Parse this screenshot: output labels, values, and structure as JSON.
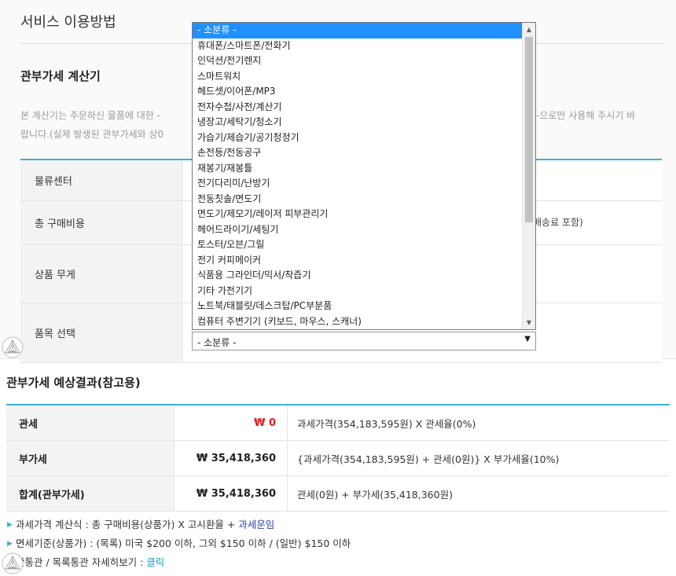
{
  "service": {
    "title": "서비스 이용방법"
  },
  "calculator": {
    "title": "관부가세 계산기",
    "desc_line1_left": "본 계산기는 주문하신 물품에 대한 -",
    "desc_line1_right": "-으로만 사용해 주시기 바",
    "desc_line2": "랍니다.(실제 발생된 관부가세와 상0",
    "rows": [
      {
        "label": "물류센터"
      },
      {
        "label": "총 구매비용",
        "note": "배송료 포함)"
      },
      {
        "label": "상품 무게"
      },
      {
        "label": "품목 선택"
      }
    ],
    "select": {
      "value": "- 소분류 -",
      "options": [
        "- 소분류 -",
        "휴대폰/스마트폰/전화기",
        "인덕션/전기렌지",
        "스마트워치",
        "헤드셋/이어폰/MP3",
        "전자수첩/사전/계산기",
        "냉장고/세탁기/청소기",
        "가습기/제습기/공기청정기",
        "손전등/전동공구",
        "재봉기/재봉틀",
        "전기다리미/난방기",
        "전동칫솔/면도기",
        "면도기/제모기/레이저 피부관리기",
        "헤어드라이기/세팅기",
        "토스터/오븐/그릴",
        "전기 커피메이커",
        "식품용 그라인더/믹서/착즙기",
        "기타 가전기기",
        "노트북/태블릿/데스크탑/PC부분품",
        "컴퓨터 주변기기 (키보드, 마우스, 스캐너)"
      ]
    }
  },
  "result": {
    "title": "관부가세 예상결과(참고용)",
    "rows": [
      {
        "label": "관세",
        "amount": "₩ 0",
        "formula": "과세가격(354,183,595원) X 관세율(0%)"
      },
      {
        "label": "부가세",
        "amount": "₩ 35,418,360",
        "formula": "{과세가격(354,183,595원) + 관세(0원)} X 부가세율(10%)"
      },
      {
        "label": "합계(관부가세)",
        "amount": "₩ 35,418,360",
        "formula": "관세(0원) + 부가세(35,418,360원)"
      }
    ],
    "notes": {
      "n1_text": "과세가격 계산식 : 총 구매비용(상품가) X 고시환율 + ",
      "n1_link": "과세운임",
      "n2_text": "면세기준(상품가) : (목록) 미국 $200 이하, 그외 $150 이하 / (일반) $150 이하",
      "n3_text": "반통관 / 목록통관 자세히보기 : ",
      "n3_link": "클릭"
    }
  },
  "colors": {
    "accent": "#3ab1d8",
    "selected": "#1e90ff",
    "negative": "#e02020",
    "link": "#2b3fb6"
  },
  "icons": [
    "watermark-icon",
    "triangle-bullet-icon",
    "dropdown-arrow-icon",
    "scroll-up-icon",
    "scroll-down-icon"
  ]
}
